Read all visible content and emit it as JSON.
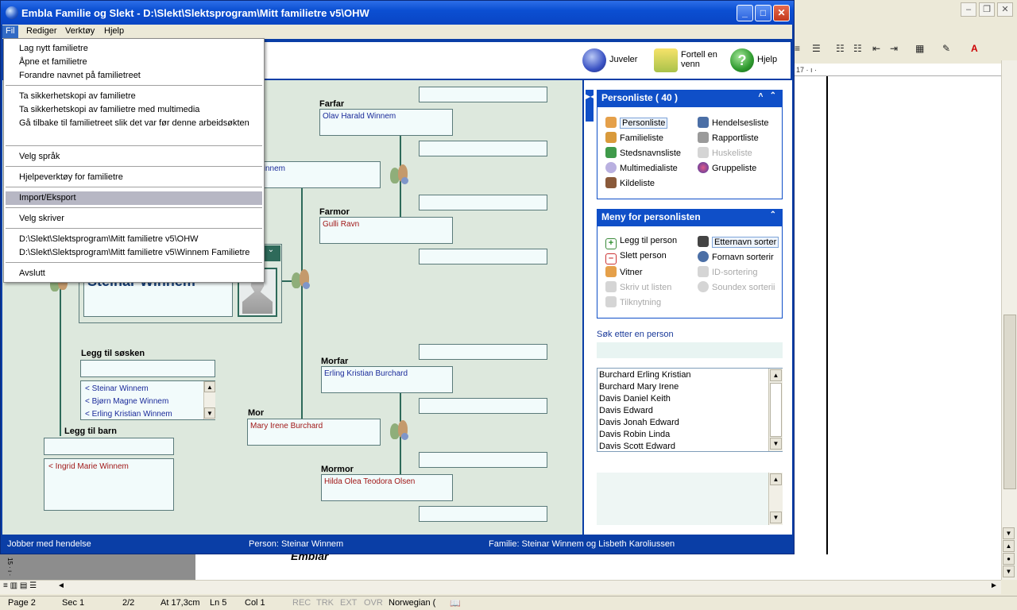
{
  "word": {
    "ruler_text": "17 · ı ·",
    "toolbar_glyphs": [
      "≡",
      "☰",
      "☷",
      "⇤",
      "⇥",
      "▦",
      "✎",
      "A"
    ],
    "status": {
      "page": "Page 2",
      "sec": "Sec 1",
      "pages": "2/2",
      "at": "At 17,3cm",
      "ln": "Ln 5",
      "col": "Col 1",
      "rec": "REC",
      "trk": "TRK",
      "ext": "EXT",
      "ovr": "OVR",
      "lang": "Norwegian ("
    },
    "doc_fragment": "Emblar",
    "vertical_ruler": "15 · ı ·"
  },
  "window": {
    "title": "Embla Familie og Slekt - D:\\Slekt\\Slektsprogram\\Mitt familietre v5\\OHW"
  },
  "menubar": [
    "Fil",
    "Rediger",
    "Verktøy",
    "Hjelp"
  ],
  "file_menu": {
    "groups": [
      [
        "Lag nytt familietre",
        "Åpne et familietre",
        "Forandre navnet på familietreet"
      ],
      [
        "Ta sikkerhetskopi av familietre",
        "Ta sikkerhetskopi av familietre med multimedia",
        "Gå tilbake til familietreet slik det var før denne arbeidsøkten",
        ""
      ],
      [
        "Velg språk"
      ],
      [
        "Hjelpeverktøy for familietre"
      ],
      [
        "Import/Eksport"
      ],
      [
        "Velg skriver"
      ],
      [
        "D:\\Slekt\\Slektsprogram\\Mitt familietre v5\\OHW",
        "D:\\Slekt\\Slektsprogram\\Mitt familietre v5\\Winnem Familietre"
      ],
      [
        "Avslutt"
      ]
    ],
    "highlighted": "Import/Eksport"
  },
  "toolbar": {
    "jewels": "Juveler",
    "tell_friend_1": "Fortell en",
    "tell_friend_2": "venn",
    "help": "Hjelp"
  },
  "tree": {
    "farfar_label": "Farfar",
    "farfar": "Olav Harald Winnem",
    "far_partial": "g Winnem",
    "farmor_label": "Farmor",
    "farmor": "Gulli Ravn",
    "main_person": "Steinar Winnem",
    "morfar_label": "Morfar",
    "morfar": "Erling Kristian Burchard",
    "mor_label": "Mor",
    "mor": "Mary Irene Burchard",
    "mormor_label": "Mormor",
    "mormor": "Hilda Olea Teodora Olsen",
    "siblings_label": "Legg til søsken",
    "siblings": [
      "< Steinar Winnem",
      "< Bjørn Magne Winnem",
      "< Erling Kristian Winnem"
    ],
    "children_label": "Legg til barn",
    "children": [
      "< Ingrid Marie Winnem"
    ]
  },
  "right": {
    "personlist_title": "Personliste ( 40 )",
    "lists_left": [
      "Personliste",
      "Familieliste",
      "Stedsnavnsliste",
      "Multimedialiste",
      "Kildeliste"
    ],
    "lists_right": [
      "Hendelsesliste",
      "Rapportliste",
      "Huskeliste",
      "Gruppeliste"
    ],
    "menu_title": "Meny for personlisten",
    "menu_left": [
      "Legg til person",
      "Slett person",
      "Vitner",
      "Skriv ut listen",
      "Tilknytning"
    ],
    "menu_right": [
      "Etternavn sorter",
      "Fornavn sorterir",
      "ID-sortering",
      "Soundex sorterii"
    ],
    "search_label": "Søk etter en person",
    "persons": [
      "Burchard Erling Kristian",
      "Burchard Mary Irene",
      "Davis Daniel Keith",
      "Davis Edward",
      "Davis Jonah Edward",
      "Davis Robin Linda",
      "Davis Scott Edward"
    ]
  },
  "status": {
    "left": "Jobber med hendelse",
    "person": "Person: Steinar Winnem",
    "family": "Familie: Steinar Winnem og Lisbeth Karoliussen"
  },
  "colors": {
    "titlebar": "#0b4fd2",
    "panel_header": "#0f4fc8",
    "tree_bg": "#dde8dd",
    "line": "#2e6a5a"
  }
}
